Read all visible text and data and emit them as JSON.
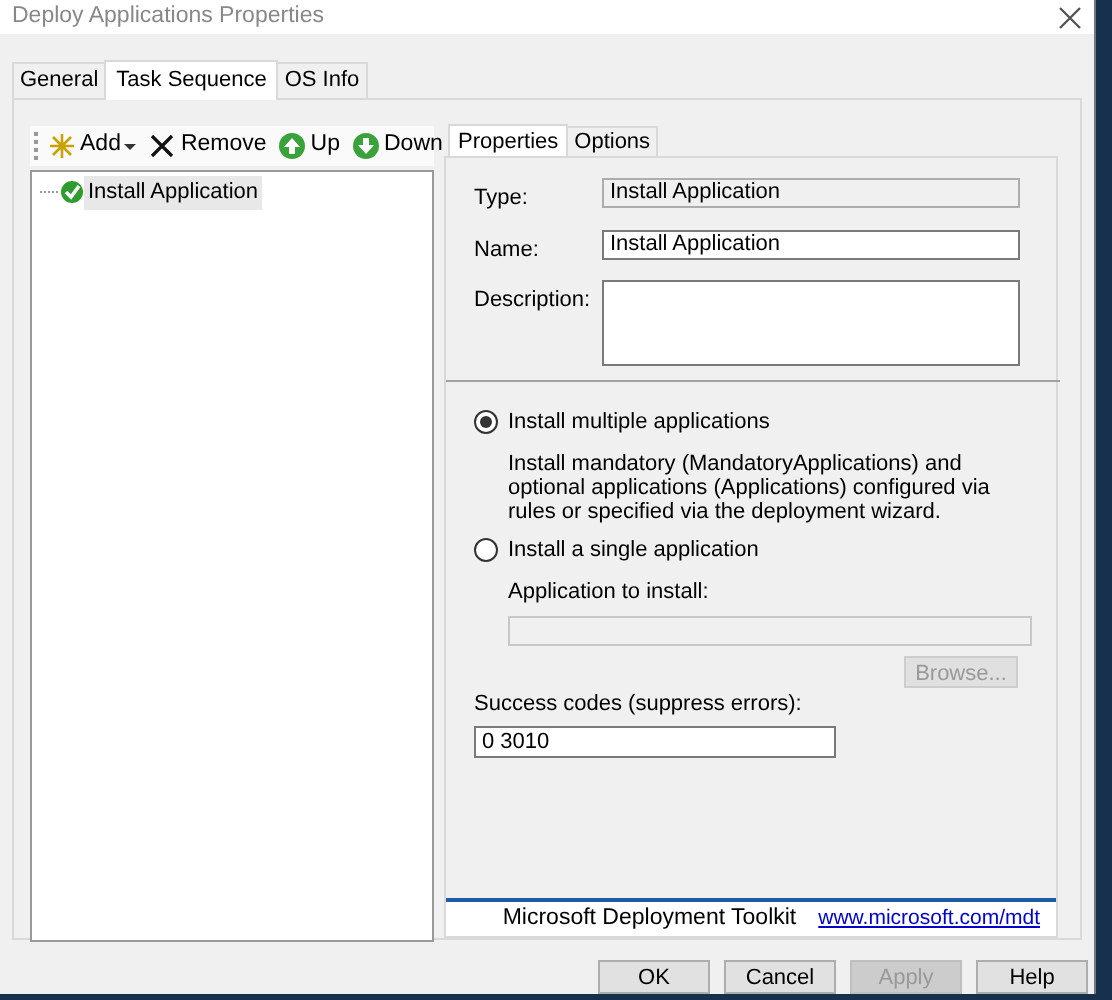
{
  "window": {
    "title": "Deploy Applications Properties"
  },
  "tabs": [
    {
      "label": "General",
      "selected": false
    },
    {
      "label": "Task Sequence",
      "selected": true
    },
    {
      "label": "OS Info",
      "selected": false
    }
  ],
  "toolbar": [
    {
      "kind": "add",
      "label": "Add",
      "dropdown": true
    },
    {
      "kind": "remove",
      "label": "Remove"
    },
    {
      "kind": "up",
      "label": "Up"
    },
    {
      "kind": "down",
      "label": "Down"
    }
  ],
  "tree": [
    {
      "label": "Install Application",
      "selected": true
    }
  ],
  "property_tabs": [
    {
      "label": "Properties",
      "selected": true
    },
    {
      "label": "Options",
      "selected": false
    }
  ],
  "fields": [
    {
      "kind": "readonly",
      "label": "Type:",
      "value": "Install Application"
    },
    {
      "kind": "text",
      "label": "Name:",
      "value": "Install Application"
    },
    {
      "kind": "multiline",
      "label": "Description:"
    }
  ],
  "options": [
    {
      "label": "Install multiple applications",
      "selected": true,
      "description": "Install mandatory (MandatoryApplications) and optional applications (Applications) configured via rules or specified via the deployment wizard."
    },
    {
      "label": "Install a single application",
      "selected": false
    }
  ],
  "application_to_install": {
    "label": "Application to install:",
    "disabled": true
  },
  "browse_button": {
    "label": "Browse...",
    "disabled": true
  },
  "success_codes": {
    "label": "Success codes (suppress errors):",
    "value": "0 3010"
  },
  "footer": {
    "product": "Microsoft Deployment Toolkit",
    "link": "www.microsoft.com/mdt"
  },
  "buttons": [
    {
      "label": "OK",
      "disabled": false
    },
    {
      "label": "Cancel",
      "disabled": false
    },
    {
      "label": "Apply",
      "disabled": true
    },
    {
      "label": "Help",
      "disabled": false
    }
  ]
}
